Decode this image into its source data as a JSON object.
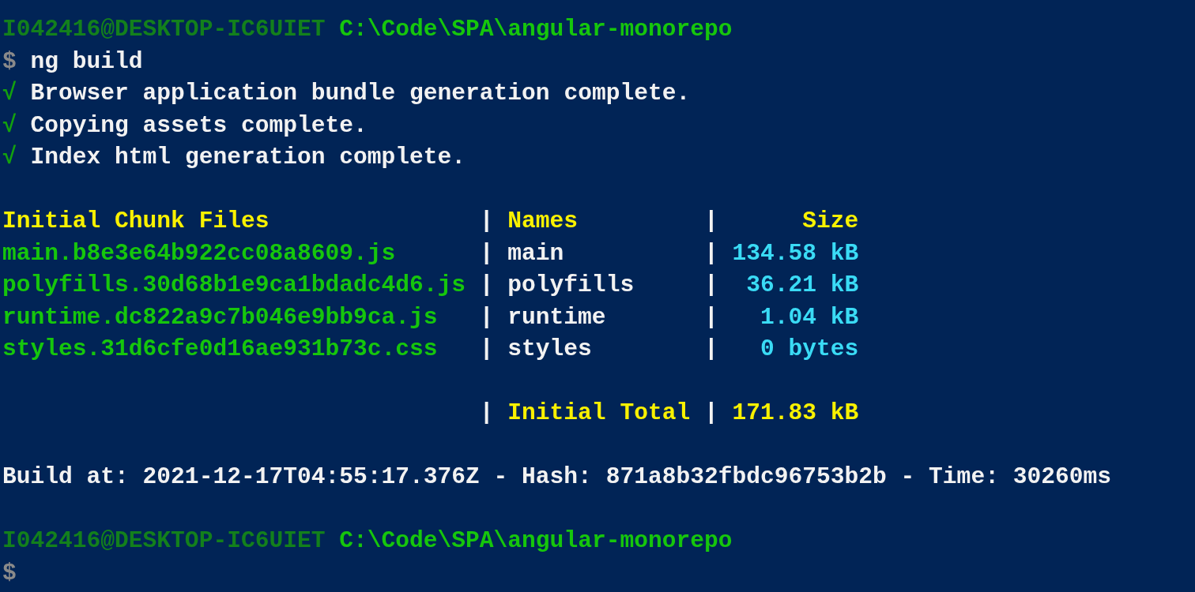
{
  "prompt": {
    "user": "I042416@DESKTOP-IC6UIET",
    "path": "C:\\Code\\SPA\\angular-monorepo"
  },
  "command": {
    "symbol": "$",
    "text": "ng build"
  },
  "status_lines": [
    {
      "mark": "√",
      "text": "Browser application bundle generation complete."
    },
    {
      "mark": "√",
      "text": "Copying assets complete."
    },
    {
      "mark": "√",
      "text": "Index html generation complete."
    }
  ],
  "table": {
    "separator": "|",
    "columns": [
      "Initial Chunk Files",
      "Names",
      "Size"
    ],
    "rows": [
      {
        "file": "main.b8e3e64b922cc08a8609.js",
        "name": "main",
        "size": "134.58 kB"
      },
      {
        "file": "polyfills.30d68b1e9ca1bdadc4d6.js",
        "name": "polyfills",
        "size": "36.21 kB"
      },
      {
        "file": "runtime.dc822a9c7b046e9bb9ca.js",
        "name": "runtime",
        "size": "1.04 kB"
      },
      {
        "file": "styles.31d6cfe0d16ae931b73c.css",
        "name": "styles",
        "size": "0 bytes"
      }
    ],
    "total": {
      "label": "Initial Total",
      "size": "171.83 kB"
    }
  },
  "summary": "Build at: 2021-12-17T04:55:17.376Z - Hash: 871a8b32fbdc96753b2b - Time: 30260ms",
  "prompt_2": {
    "user": "I042416@DESKTOP-IC6UIET",
    "path": "C:\\Code\\SPA\\angular-monorepo"
  },
  "cursor_prompt": {
    "symbol": "$"
  }
}
